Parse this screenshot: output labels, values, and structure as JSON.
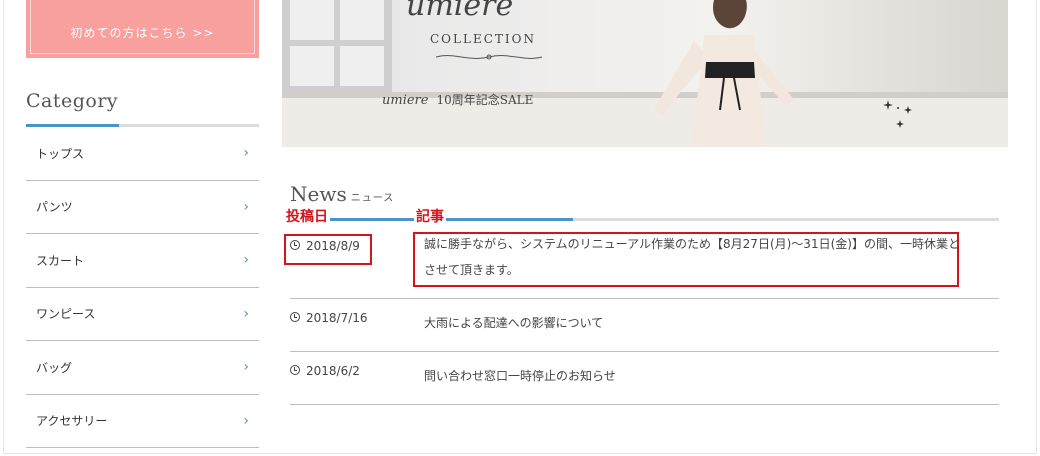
{
  "sidebar": {
    "first_time_button": "初めての方はこちら >>",
    "category_title": "Category",
    "chevron_glyph": "›",
    "categories": [
      {
        "label": "トップス"
      },
      {
        "label": "パンツ"
      },
      {
        "label": "スカート"
      },
      {
        "label": "ワンピース"
      },
      {
        "label": "バッグ"
      },
      {
        "label": "アクセサリー"
      }
    ]
  },
  "banner": {
    "script_title": "umiere",
    "collection_text": "COLLECTION",
    "sale_brand": "umiere",
    "sale_text": "10周年記念SALE"
  },
  "news": {
    "heading_en": "News",
    "heading_ja": "ニュース",
    "annotation_date_label": "投稿日",
    "annotation_article_label": "記事",
    "items": [
      {
        "date": "2018/8/9",
        "title": "誠に勝手ながら、システムのリニューアル作業のため【8月27日(月)〜31日(金)】の間、一時休業とさせて頂きます。"
      },
      {
        "date": "2018/7/16",
        "title": "大雨による配達への影響について"
      },
      {
        "date": "2018/6/2",
        "title": "問い合わせ窓口一時停止のお知らせ"
      }
    ]
  },
  "colors": {
    "accent_blue": "#4a94c9",
    "pink_button": "#f7a09e",
    "annotation_red": "#d4131b"
  }
}
